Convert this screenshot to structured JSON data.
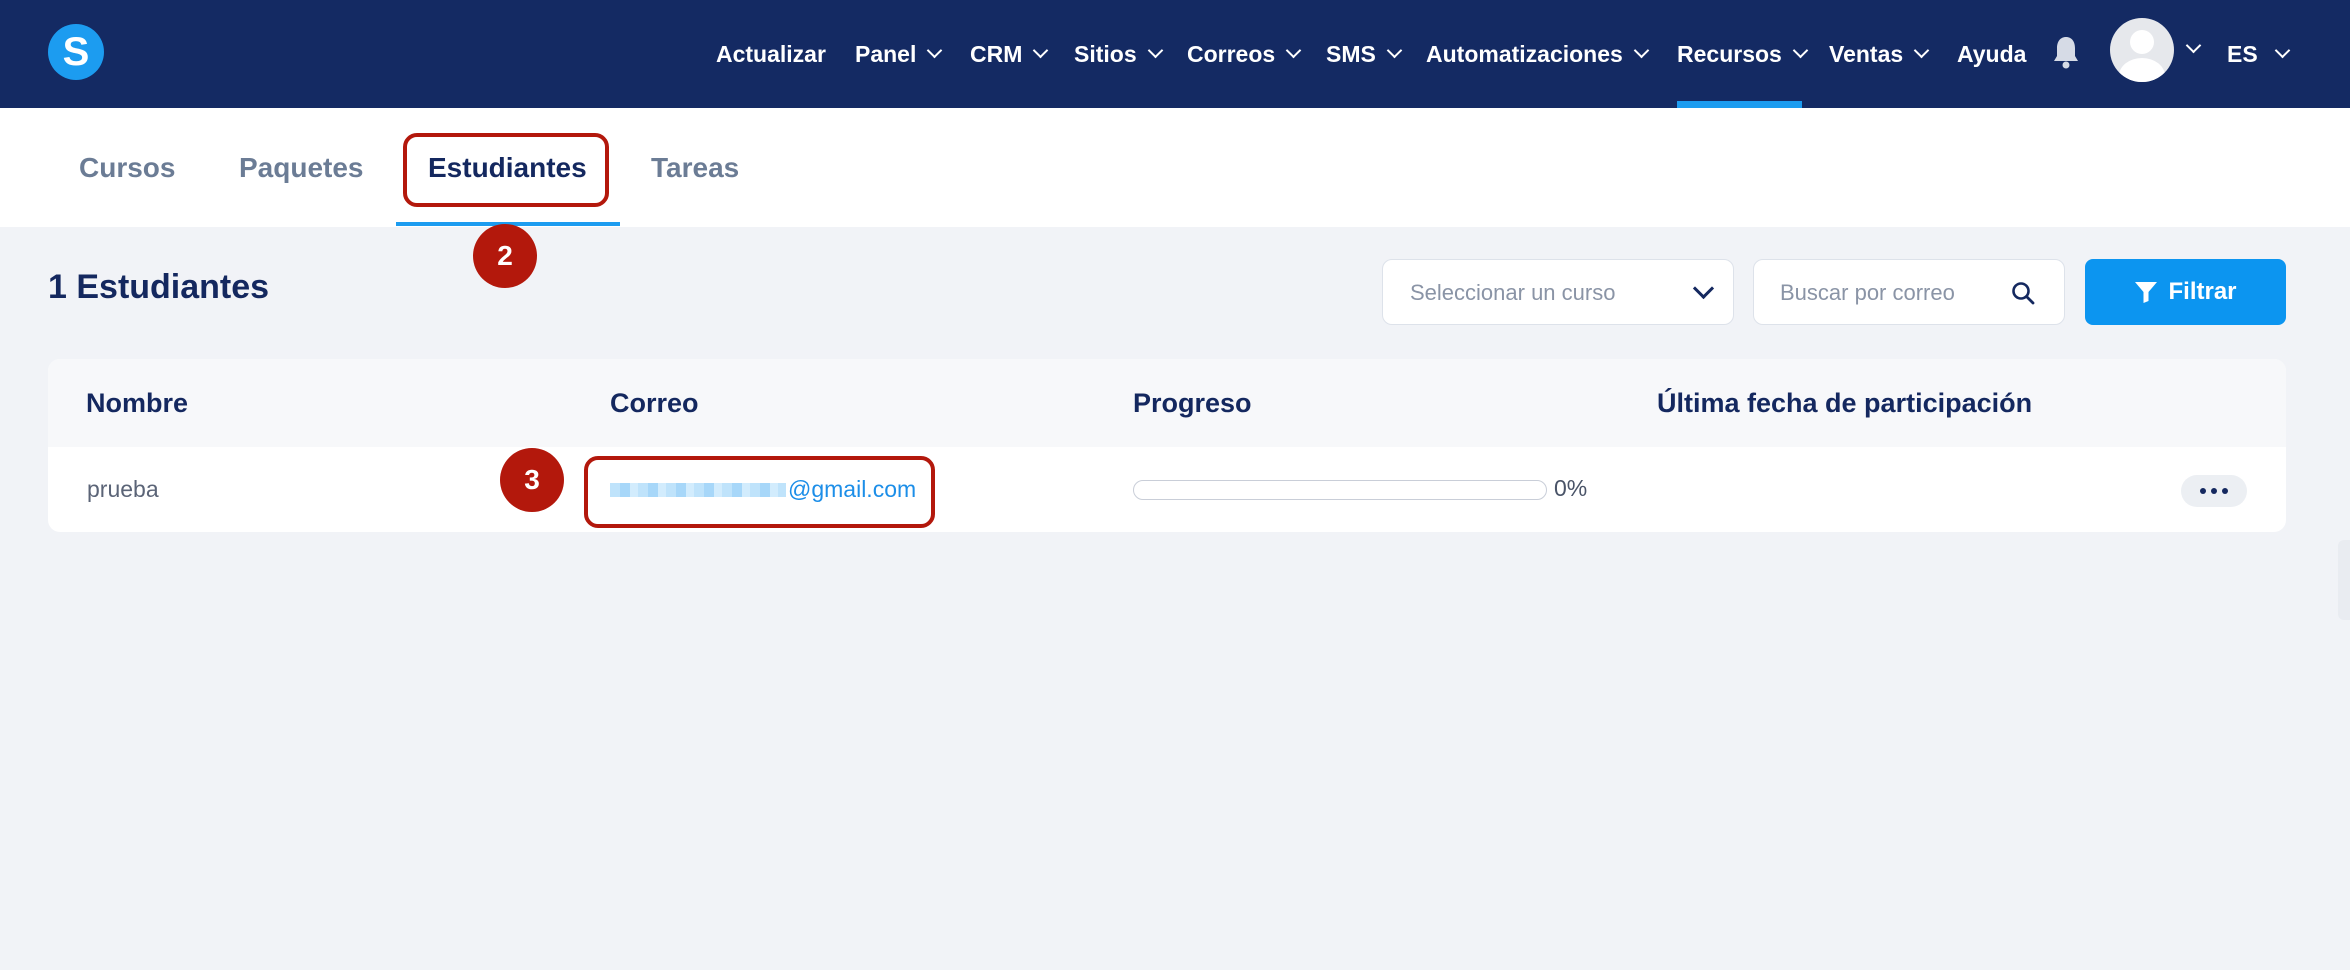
{
  "app": {
    "logo_letter": "S"
  },
  "nav": {
    "items": [
      {
        "label": "Actualizar",
        "dropdown": false
      },
      {
        "label": "Panel",
        "dropdown": true
      },
      {
        "label": "CRM",
        "dropdown": true
      },
      {
        "label": "Sitios",
        "dropdown": true
      },
      {
        "label": "Correos",
        "dropdown": true
      },
      {
        "label": "SMS",
        "dropdown": true
      },
      {
        "label": "Automatizaciones",
        "dropdown": true
      },
      {
        "label": "Recursos",
        "dropdown": true,
        "active": true
      },
      {
        "label": "Ventas",
        "dropdown": true
      },
      {
        "label": "Ayuda",
        "dropdown": false
      }
    ],
    "language": "ES"
  },
  "tabs": [
    {
      "label": "Cursos"
    },
    {
      "label": "Paquetes"
    },
    {
      "label": "Estudiantes",
      "active": true
    },
    {
      "label": "Tareas"
    }
  ],
  "annotations": [
    "2",
    "3"
  ],
  "toolbar": {
    "count_title": "1 Estudiantes",
    "course_select_placeholder": "Seleccionar un curso",
    "search_placeholder": "Buscar por correo",
    "filter_label": "Filtrar"
  },
  "table": {
    "headers": [
      "Nombre",
      "Correo",
      "Progreso",
      "Última fecha de participación"
    ],
    "rows": [
      {
        "name": "prueba",
        "email_domain": "@gmail.com",
        "progress": 0,
        "progress_label": "0%",
        "last_date": ""
      }
    ]
  },
  "colors": {
    "nav_bg": "#142a63",
    "accent": "#1c9cf0",
    "filter_button": "#0c95f0",
    "annotation": "#b3180c",
    "page_bg": "#f1f3f7"
  }
}
